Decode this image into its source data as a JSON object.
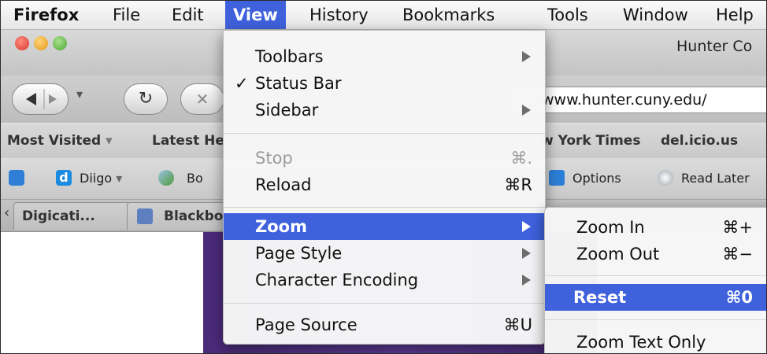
{
  "menubar": {
    "app": "Firefox",
    "items": [
      "File",
      "Edit",
      "View",
      "History",
      "Bookmarks",
      "Tools",
      "Window",
      "Help"
    ]
  },
  "window": {
    "title": "Hunter Co"
  },
  "nav": {
    "url": "www.hunter.cuny.edu/"
  },
  "bookmarks": {
    "most_visited": "Most Visited",
    "latest": "Latest He",
    "nyt": "w York Times",
    "delicious": "del.icio.us"
  },
  "toolbar": {
    "diigo": "Diigo",
    "bo": "Bo",
    "options": "Options",
    "read_later": "Read Later"
  },
  "tabs": [
    "Digicati...",
    "Blackbo"
  ],
  "view_menu": {
    "toolbars": "Toolbars",
    "status_bar": "Status Bar",
    "sidebar": "Sidebar",
    "stop": "Stop",
    "stop_shortcut": "⌘.",
    "reload": "Reload",
    "reload_shortcut": "⌘R",
    "zoom": "Zoom",
    "page_style": "Page Style",
    "char_encoding": "Character Encoding",
    "page_source": "Page Source",
    "page_source_shortcut": "⌘U",
    "check_mark": "✓"
  },
  "zoom_menu": {
    "zoom_in": "Zoom In",
    "zoom_in_shortcut": "⌘+",
    "zoom_out": "Zoom Out",
    "zoom_out_shortcut": "⌘−",
    "reset": "Reset",
    "reset_shortcut": "⌘0",
    "zoom_text_only": "Zoom Text Only"
  },
  "colors": {
    "highlight": "#3f61dc",
    "banner": "#5d3a94"
  }
}
